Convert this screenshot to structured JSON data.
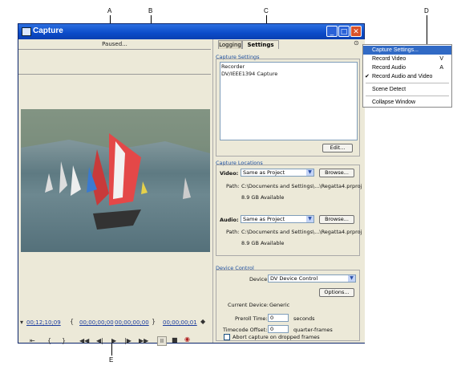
{
  "callouts": {
    "a": "A",
    "b": "B",
    "c": "C",
    "d": "D",
    "e": "E"
  },
  "window": {
    "title": "Capture"
  },
  "monitor": {
    "status": "Paused...",
    "timecode_left": "00;12;10;09",
    "in_point": "00;00;00;00",
    "out_point": "00;00;00;00",
    "duration": "00;00;00;01"
  },
  "tabs": {
    "logging": "Logging",
    "settings": "Settings"
  },
  "capture_settings": {
    "group_label": "Capture Settings",
    "line1": "Recorder",
    "line2": "DV/IEEE1394 Capture",
    "edit_button": "Edit..."
  },
  "capture_locations": {
    "group_label": "Capture Locations",
    "video_label": "Video:",
    "video_value": "Same as Project",
    "video_browse": "Browse...",
    "video_path_label": "Path:",
    "video_path": "C:\\Documents and Settings\\...\\Regatta4.prproj",
    "video_available": "8.9 GB Available",
    "audio_label": "Audio:",
    "audio_value": "Same as Project",
    "audio_browse": "Browse...",
    "audio_path_label": "Path:",
    "audio_path": "C:\\Documents and Settings\\...\\Regatta4.prproj",
    "audio_available": "8.9 GB Available"
  },
  "device_control": {
    "group_label": "Device Control",
    "device_label": "Device:",
    "device_value": "DV Device Control",
    "options_button": "Options...",
    "current_device_label": "Current Device:",
    "current_device_value": "Generic",
    "preroll_label": "Preroll Time:",
    "preroll_value": "0",
    "preroll_unit": "seconds",
    "offset_label": "Timecode Offset:",
    "offset_value": "0",
    "offset_unit": "quarter-frames",
    "abort_label": "Abort capture on dropped frames"
  },
  "menu": {
    "items": [
      {
        "label": "Capture Settings...",
        "key": ""
      },
      {
        "label": "Record Video",
        "key": "V"
      },
      {
        "label": "Record Audio",
        "key": "A"
      },
      {
        "label": "Record Audio and Video",
        "key": ""
      },
      {
        "label": "Scene Detect",
        "key": ""
      },
      {
        "label": "Collapse Window",
        "key": ""
      }
    ]
  },
  "icons": {
    "transport": [
      "step-back-icon",
      "frame-back-icon",
      "play-icon",
      "frame-forward-icon",
      "fast-forward-icon",
      "pause-icon",
      "stop-icon",
      "record-icon"
    ]
  }
}
